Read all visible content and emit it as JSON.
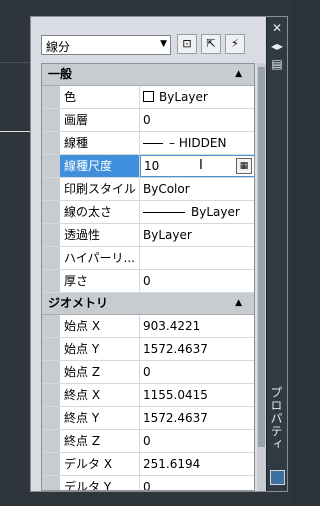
{
  "palette": {
    "title": "プロパティ",
    "object_type": "線分"
  },
  "sections": {
    "general": "一般",
    "geometry": "ジオメトリ"
  },
  "general": {
    "color": {
      "name": "色",
      "value": "ByLayer"
    },
    "layer": {
      "name": "画層",
      "value": "0"
    },
    "linetype": {
      "name": "線種",
      "value": "– HIDDEN"
    },
    "linetype_scale": {
      "name": "線種尺度",
      "value": "10"
    },
    "plot_style": {
      "name": "印刷スタイル",
      "value": "ByColor"
    },
    "lineweight": {
      "name": "線の太さ",
      "value": "ByLayer"
    },
    "transparency": {
      "name": "透過性",
      "value": "ByLayer"
    },
    "hyperlink": {
      "name": "ハイパーリ...",
      "value": ""
    },
    "thickness": {
      "name": "厚さ",
      "value": "0"
    }
  },
  "geometry": {
    "start_x": {
      "name": "始点 X",
      "value": "903.4221"
    },
    "start_y": {
      "name": "始点 Y",
      "value": "1572.4637"
    },
    "start_z": {
      "name": "始点 Z",
      "value": "0"
    },
    "end_x": {
      "name": "終点 X",
      "value": "1155.0415"
    },
    "end_y": {
      "name": "終点 Y",
      "value": "1572.4637"
    },
    "end_z": {
      "name": "終点 Z",
      "value": "0"
    },
    "delta_x": {
      "name": "デルタ X",
      "value": "251.6194"
    },
    "delta_y": {
      "name": "デルタ Y",
      "value": "0"
    }
  },
  "icons": {
    "close": "close-icon",
    "autohide": "autohide-icon",
    "menu": "menu-icon",
    "calculator": "calculator-icon"
  },
  "colors": {
    "selection": "#3f8fdc",
    "titlebar": "#2f3a42"
  }
}
